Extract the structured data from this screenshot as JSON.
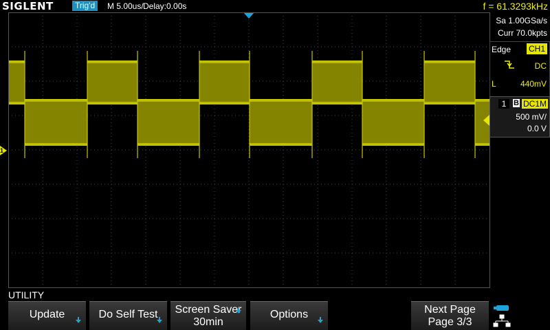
{
  "header": {
    "brand": "SIGLENT",
    "trigger_status": "Trig'd",
    "timebase": "M 5.00us/",
    "delay": "Delay:0.00s",
    "frequency": "f = 61.3293kHz"
  },
  "acquisition": {
    "sample_rate": "Sa 1.00GSa/s",
    "memory_depth": "Curr 70.0kpts"
  },
  "trigger": {
    "type": "Edge",
    "source": "CH1",
    "coupling": "DC",
    "level_label": "L",
    "level": "440mV",
    "slope_icon": "falling-edge-icon"
  },
  "channel1": {
    "number": "1",
    "bw_limit": "B",
    "coupling": "DC1M",
    "scale": "500 mV/",
    "offset": "0.0 V",
    "marker": "1",
    "color": "#e6e600"
  },
  "menu": {
    "title": "UTILITY",
    "softkeys": [
      {
        "line1": "Update",
        "line2": ""
      },
      {
        "line1": "Do Self Test",
        "line2": ""
      },
      {
        "line1": "Screen Saver",
        "line2": "30min"
      },
      {
        "line1": "Options",
        "line2": ""
      },
      {
        "line1": "Next Page",
        "line2": "Page 3/3"
      }
    ]
  },
  "colors": {
    "trace": "#c8c800",
    "accent": "#1ea3d8",
    "trigger_source_bg": "#e6e600"
  }
}
